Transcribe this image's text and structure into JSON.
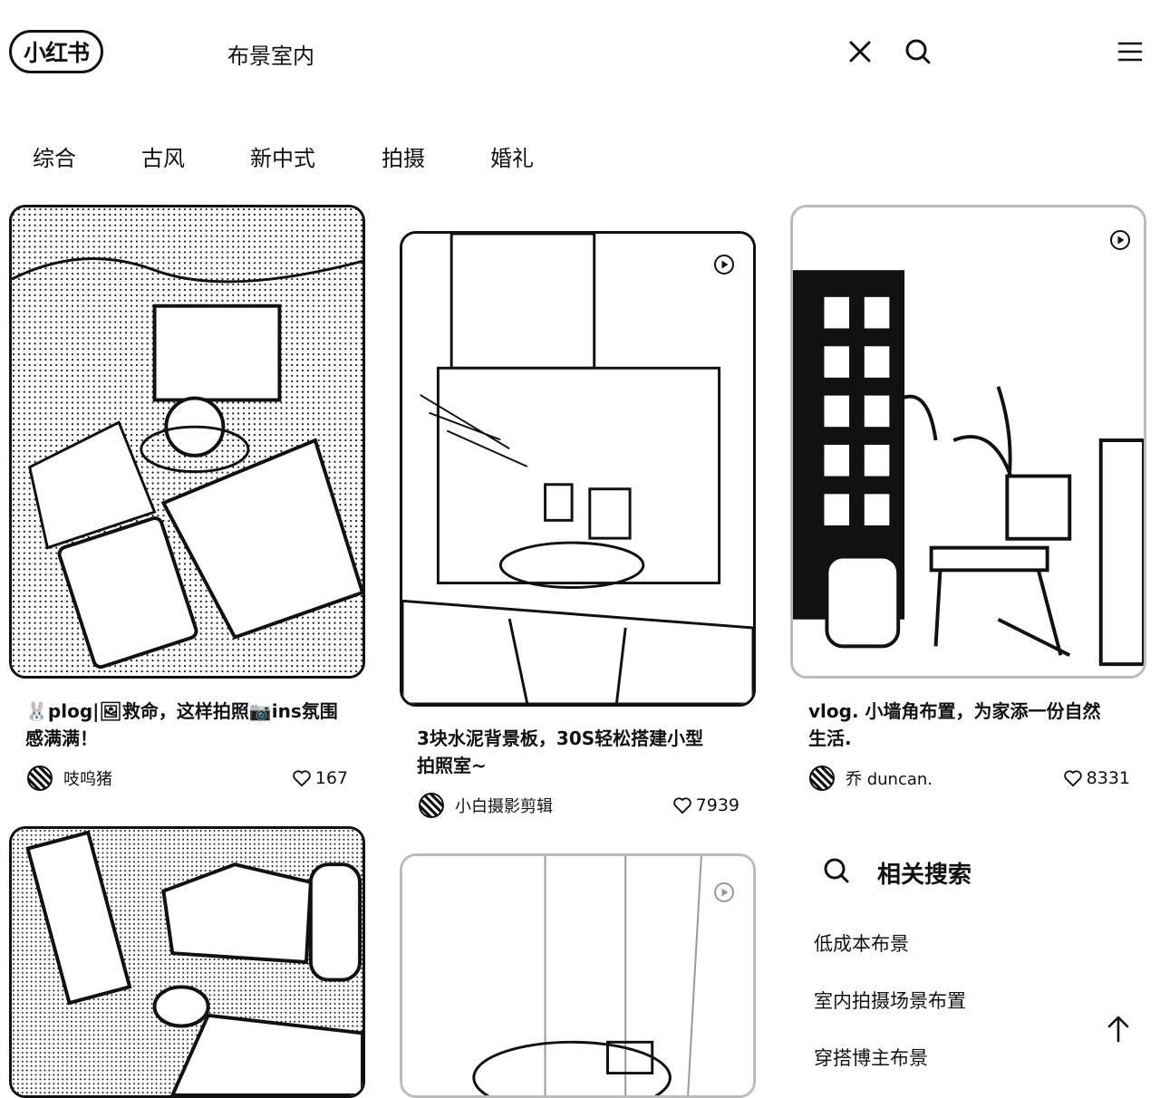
{
  "header": {
    "logo_text": "小红书",
    "search_query": "布景室内",
    "icons": {
      "clear": "close-icon",
      "search": "search-icon",
      "menu": "menu-icon"
    }
  },
  "tabs": [
    "综合",
    "古风",
    "新中式",
    "拍摄",
    "婚礼"
  ],
  "notes": [
    {
      "title_line1": "🐰plog|🖼救命，这样拍照📷ins氛围",
      "title_line2": "感满满！",
      "author": "吱呜猪",
      "likes": "167"
    },
    {
      "title_line1": "3块水泥背景板，30S轻松搭建小型",
      "title_line2": "拍照室~",
      "author": "小白摄影剪辑",
      "likes": "7939"
    },
    {
      "title_line1": "vlog. 小墙角布置，为家添一份自然",
      "title_line2": "生活.",
      "author": "乔 duncan.",
      "likes": "8331"
    }
  ],
  "related": {
    "title": "相关搜索",
    "items": [
      "低成本布景",
      "室内拍摄场景布置",
      "穿搭博主布景"
    ]
  },
  "icons": {
    "like": "heart-icon",
    "video": "play-icon",
    "back_to_top": "arrow-up-icon"
  }
}
